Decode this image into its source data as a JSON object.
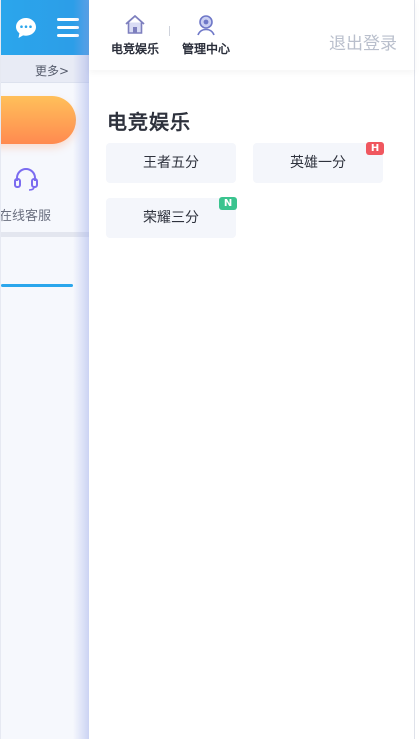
{
  "background_page": {
    "more_label": "更多>",
    "support_label": "在线客服",
    "header_color": "#2ba6ec",
    "accent_orange": "#ff8a50"
  },
  "drawer": {
    "nav": [
      {
        "label": "电竞娱乐",
        "icon": "home-icon"
      },
      {
        "label": "管理中心",
        "icon": "user-icon"
      }
    ],
    "logout_label": "退出登录",
    "section_title": "电竞娱乐",
    "games": [
      {
        "label": "王者五分",
        "badge": ""
      },
      {
        "label": "英雄一分",
        "badge": "H",
        "badge_color": "#f0575f"
      },
      {
        "label": "荣耀三分",
        "badge": "N",
        "badge_color": "#3bc48f"
      }
    ]
  }
}
